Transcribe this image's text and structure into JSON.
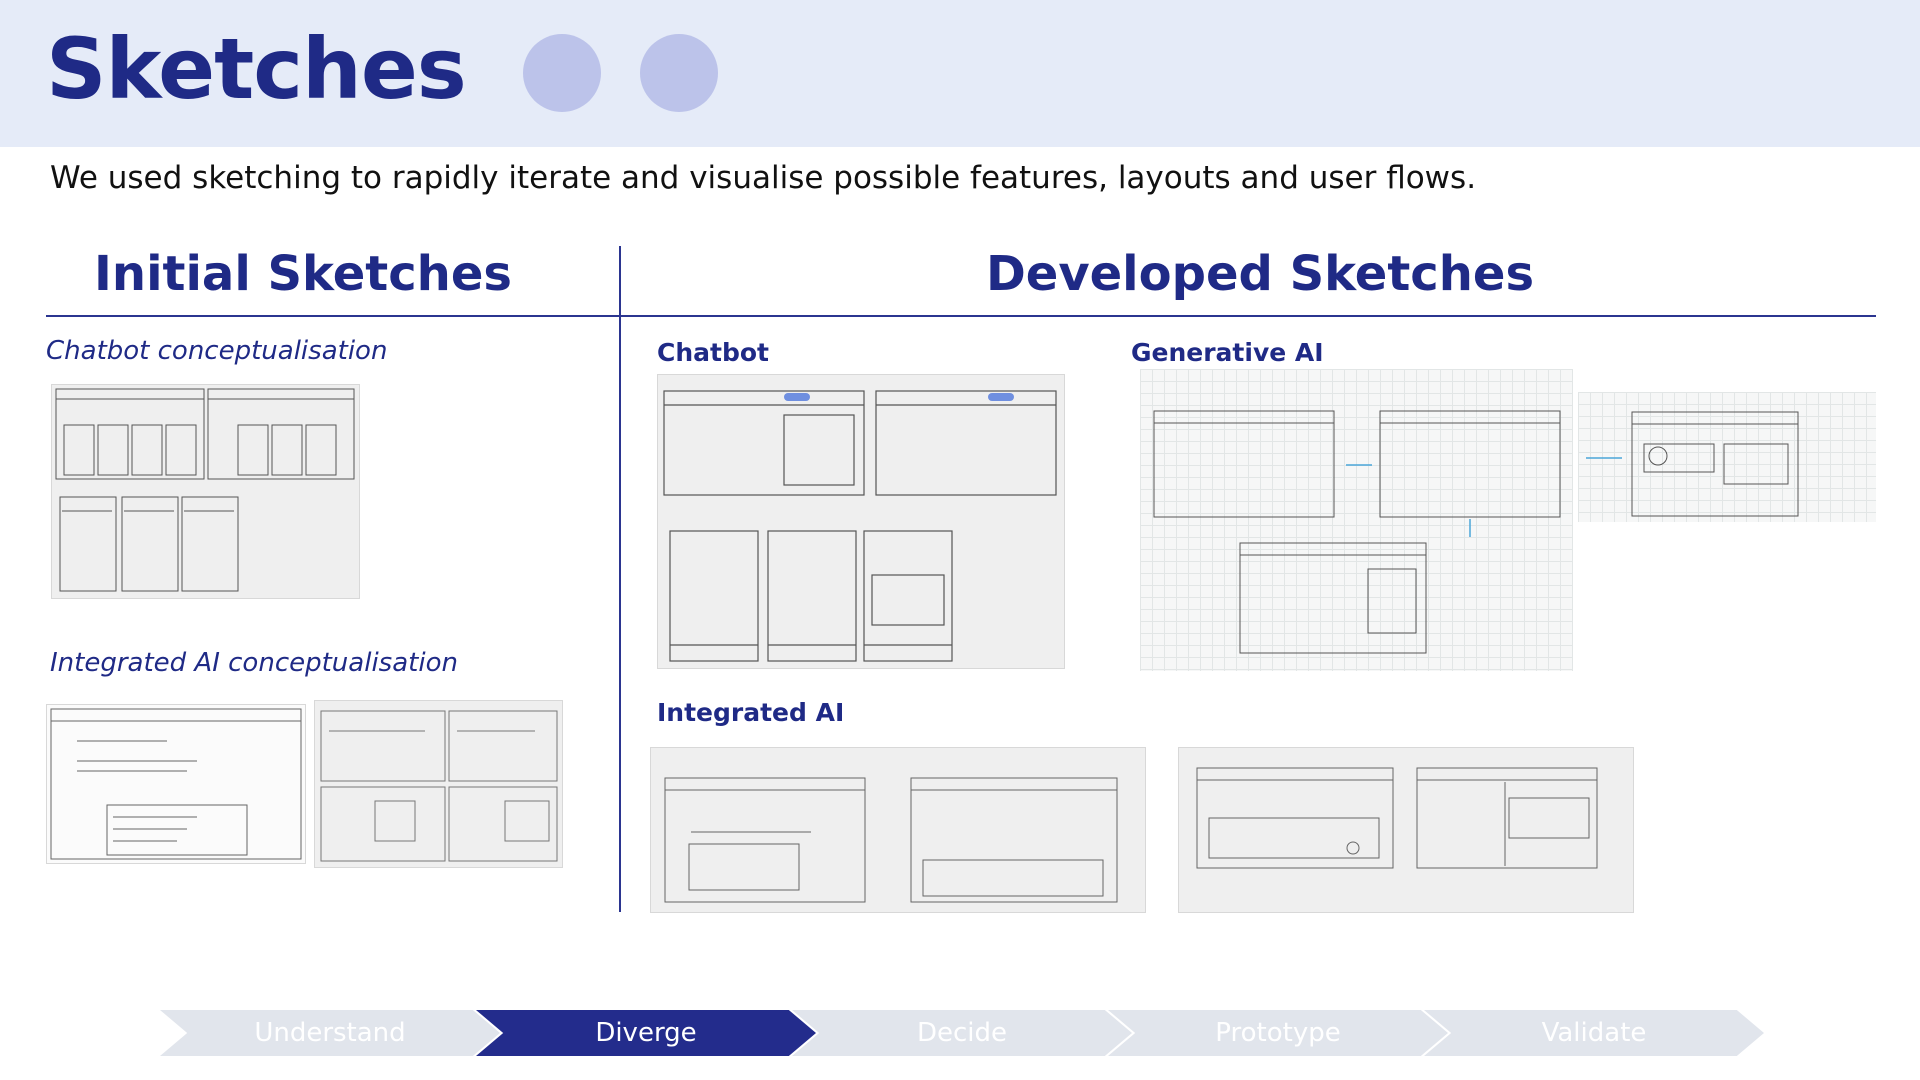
{
  "header": {
    "title": "Sketches",
    "subtitle": "We used sketching to rapidly iterate and visualise possible features, layouts and user flows."
  },
  "sections": {
    "initial": {
      "heading": "Initial Sketches",
      "chatbot_label": "Chatbot conceptualisation",
      "integrated_label": "Integrated AI conceptualisation"
    },
    "developed": {
      "heading": "Developed Sketches",
      "chatbot_label": "Chatbot",
      "generative_label": "Generative AI",
      "integrated_label": "Integrated AI"
    }
  },
  "stepper": {
    "steps": [
      "Understand",
      "Diverge",
      "Decide",
      "Prototype",
      "Validate"
    ],
    "active": "Diverge"
  },
  "colors": {
    "accent": "#1f2a86",
    "header_bg": "#e5ebf8",
    "dot": "#bcc3ea",
    "step_inactive": "#e1e5ec",
    "step_active": "#232c8c"
  }
}
